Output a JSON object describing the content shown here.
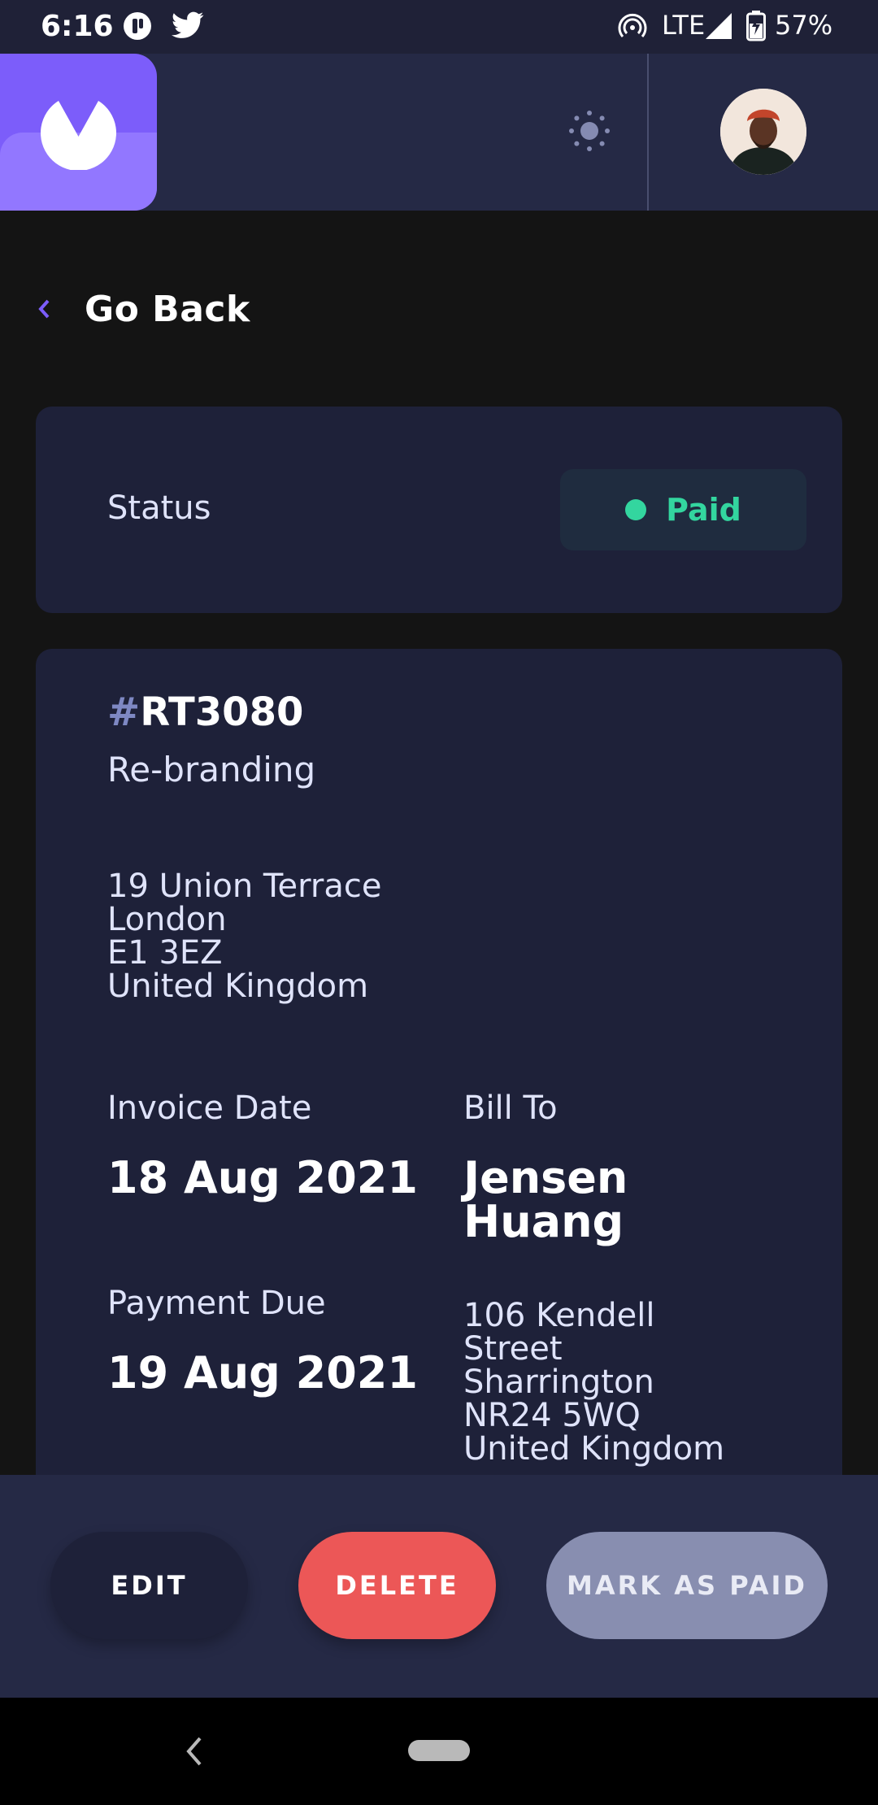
{
  "status_bar": {
    "time": "6:16",
    "network": "LTE",
    "battery": "57%"
  },
  "header": {
    "logo_icon": "brand-logo-icon",
    "theme_icon": "sun-icon",
    "avatar_icon": "user-avatar"
  },
  "nav": {
    "go_back_label": "Go Back",
    "back_icon": "chevron-left-icon"
  },
  "status": {
    "label": "Status",
    "value": "Paid",
    "color": "#33d69f"
  },
  "invoice": {
    "hash": "#",
    "id": "RT3080",
    "description": "Re-branding",
    "sender_address": [
      "19 Union Terrace",
      "London",
      "E1 3EZ",
      "United Kingdom"
    ],
    "invoice_date_label": "Invoice Date",
    "invoice_date": "18 Aug 2021",
    "payment_due_label": "Payment Due",
    "payment_due": "19 Aug 2021",
    "bill_to_label": "Bill To",
    "client_name": [
      "Jensen",
      "Huang"
    ],
    "client_address": [
      "106 Kendell",
      "Street",
      "Sharrington",
      "NR24 5WQ",
      "United Kingdom"
    ]
  },
  "actions": {
    "edit": "EDIT",
    "delete": "DELETE",
    "mark_paid": "MARK AS PAID"
  },
  "colors": {
    "accent": "#7c5dfa",
    "danger": "#ec5757",
    "paid": "#33d69f"
  }
}
